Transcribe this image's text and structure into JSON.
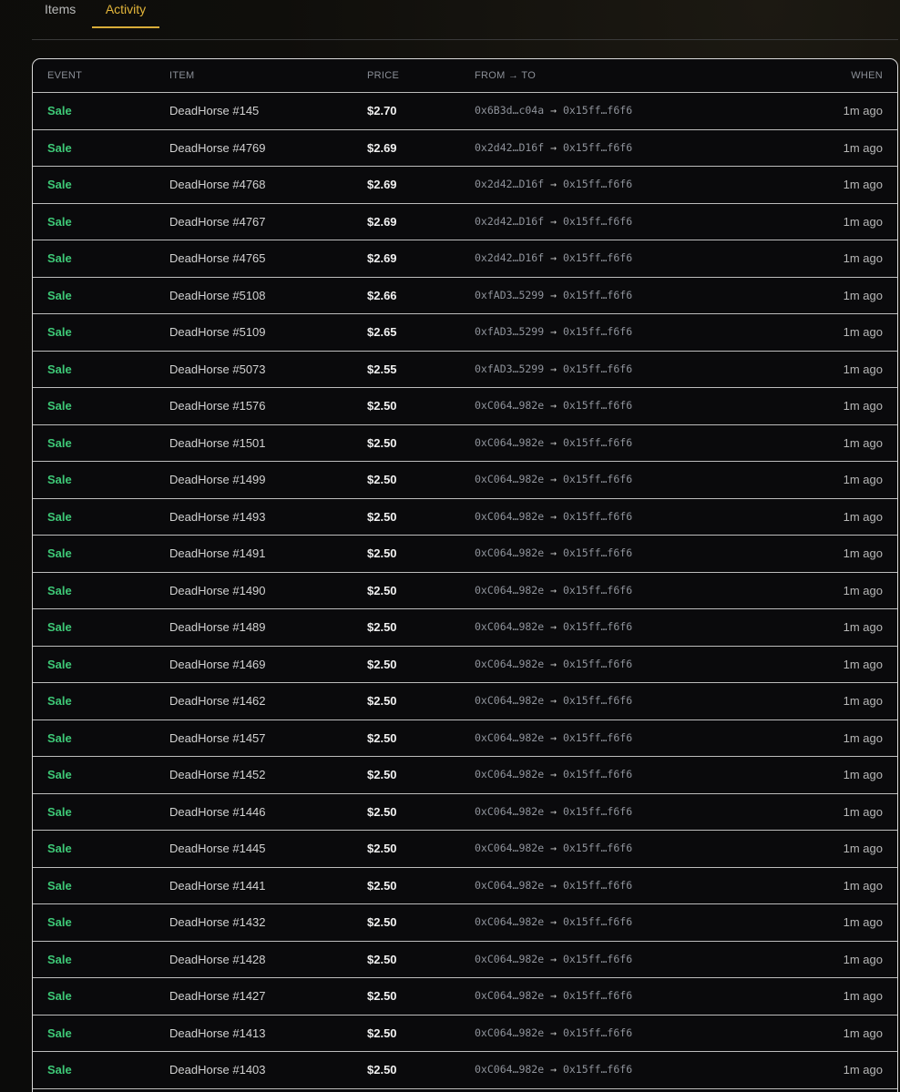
{
  "tabs": [
    {
      "label": "Items",
      "active": false
    },
    {
      "label": "Activity",
      "active": true
    }
  ],
  "table": {
    "headers": {
      "event": "EVENT",
      "item": "ITEM",
      "price": "PRICE",
      "from_to": "FROM → TO",
      "when": "WHEN"
    },
    "rows": [
      {
        "event": "Sale",
        "item": "DeadHorse #145",
        "price": "$2.70",
        "from": "0x6B3d…c04a",
        "to": "0x15ff…f6f6",
        "when": "1m ago"
      },
      {
        "event": "Sale",
        "item": "DeadHorse #4769",
        "price": "$2.69",
        "from": "0x2d42…D16f",
        "to": "0x15ff…f6f6",
        "when": "1m ago"
      },
      {
        "event": "Sale",
        "item": "DeadHorse #4768",
        "price": "$2.69",
        "from": "0x2d42…D16f",
        "to": "0x15ff…f6f6",
        "when": "1m ago"
      },
      {
        "event": "Sale",
        "item": "DeadHorse #4767",
        "price": "$2.69",
        "from": "0x2d42…D16f",
        "to": "0x15ff…f6f6",
        "when": "1m ago"
      },
      {
        "event": "Sale",
        "item": "DeadHorse #4765",
        "price": "$2.69",
        "from": "0x2d42…D16f",
        "to": "0x15ff…f6f6",
        "when": "1m ago"
      },
      {
        "event": "Sale",
        "item": "DeadHorse #5108",
        "price": "$2.66",
        "from": "0xfAD3…5299",
        "to": "0x15ff…f6f6",
        "when": "1m ago"
      },
      {
        "event": "Sale",
        "item": "DeadHorse #5109",
        "price": "$2.65",
        "from": "0xfAD3…5299",
        "to": "0x15ff…f6f6",
        "when": "1m ago"
      },
      {
        "event": "Sale",
        "item": "DeadHorse #5073",
        "price": "$2.55",
        "from": "0xfAD3…5299",
        "to": "0x15ff…f6f6",
        "when": "1m ago"
      },
      {
        "event": "Sale",
        "item": "DeadHorse #1576",
        "price": "$2.50",
        "from": "0xC064…982e",
        "to": "0x15ff…f6f6",
        "when": "1m ago"
      },
      {
        "event": "Sale",
        "item": "DeadHorse #1501",
        "price": "$2.50",
        "from": "0xC064…982e",
        "to": "0x15ff…f6f6",
        "when": "1m ago"
      },
      {
        "event": "Sale",
        "item": "DeadHorse #1499",
        "price": "$2.50",
        "from": "0xC064…982e",
        "to": "0x15ff…f6f6",
        "when": "1m ago"
      },
      {
        "event": "Sale",
        "item": "DeadHorse #1493",
        "price": "$2.50",
        "from": "0xC064…982e",
        "to": "0x15ff…f6f6",
        "when": "1m ago"
      },
      {
        "event": "Sale",
        "item": "DeadHorse #1491",
        "price": "$2.50",
        "from": "0xC064…982e",
        "to": "0x15ff…f6f6",
        "when": "1m ago"
      },
      {
        "event": "Sale",
        "item": "DeadHorse #1490",
        "price": "$2.50",
        "from": "0xC064…982e",
        "to": "0x15ff…f6f6",
        "when": "1m ago"
      },
      {
        "event": "Sale",
        "item": "DeadHorse #1489",
        "price": "$2.50",
        "from": "0xC064…982e",
        "to": "0x15ff…f6f6",
        "when": "1m ago"
      },
      {
        "event": "Sale",
        "item": "DeadHorse #1469",
        "price": "$2.50",
        "from": "0xC064…982e",
        "to": "0x15ff…f6f6",
        "when": "1m ago"
      },
      {
        "event": "Sale",
        "item": "DeadHorse #1462",
        "price": "$2.50",
        "from": "0xC064…982e",
        "to": "0x15ff…f6f6",
        "when": "1m ago"
      },
      {
        "event": "Sale",
        "item": "DeadHorse #1457",
        "price": "$2.50",
        "from": "0xC064…982e",
        "to": "0x15ff…f6f6",
        "when": "1m ago"
      },
      {
        "event": "Sale",
        "item": "DeadHorse #1452",
        "price": "$2.50",
        "from": "0xC064…982e",
        "to": "0x15ff…f6f6",
        "when": "1m ago"
      },
      {
        "event": "Sale",
        "item": "DeadHorse #1446",
        "price": "$2.50",
        "from": "0xC064…982e",
        "to": "0x15ff…f6f6",
        "when": "1m ago"
      },
      {
        "event": "Sale",
        "item": "DeadHorse #1445",
        "price": "$2.50",
        "from": "0xC064…982e",
        "to": "0x15ff…f6f6",
        "when": "1m ago"
      },
      {
        "event": "Sale",
        "item": "DeadHorse #1441",
        "price": "$2.50",
        "from": "0xC064…982e",
        "to": "0x15ff…f6f6",
        "when": "1m ago"
      },
      {
        "event": "Sale",
        "item": "DeadHorse #1432",
        "price": "$2.50",
        "from": "0xC064…982e",
        "to": "0x15ff…f6f6",
        "when": "1m ago"
      },
      {
        "event": "Sale",
        "item": "DeadHorse #1428",
        "price": "$2.50",
        "from": "0xC064…982e",
        "to": "0x15ff…f6f6",
        "when": "1m ago"
      },
      {
        "event": "Sale",
        "item": "DeadHorse #1427",
        "price": "$2.50",
        "from": "0xC064…982e",
        "to": "0x15ff…f6f6",
        "when": "1m ago"
      },
      {
        "event": "Sale",
        "item": "DeadHorse #1413",
        "price": "$2.50",
        "from": "0xC064…982e",
        "to": "0x15ff…f6f6",
        "when": "1m ago"
      },
      {
        "event": "Sale",
        "item": "DeadHorse #1403",
        "price": "$2.50",
        "from": "0xC064…982e",
        "to": "0x15ff…f6f6",
        "when": "1m ago"
      }
    ]
  }
}
